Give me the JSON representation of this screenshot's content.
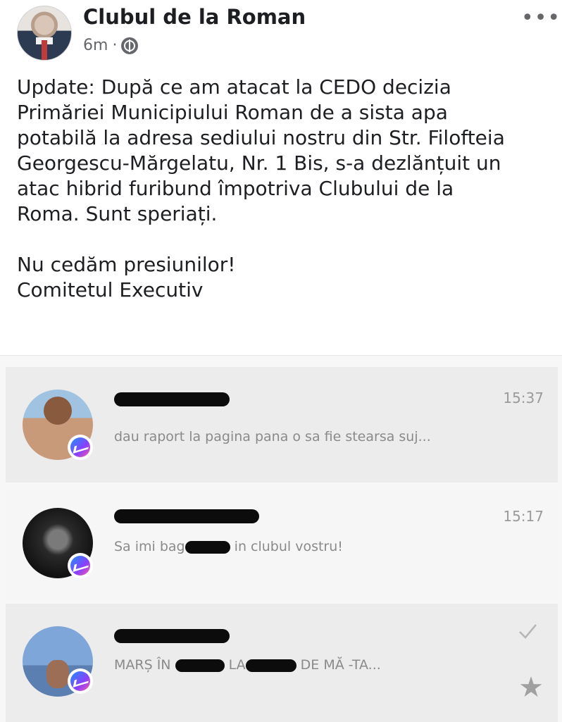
{
  "post": {
    "author": "Clubul de la Roman",
    "time": "6m",
    "separator": "·",
    "audience_icon": "globe-icon",
    "more_icon": "•••",
    "paragraph1": [
      "Update: După ce am atacat la CEDO decizia",
      "Primăriei Municipiului Roman de a sista apa",
      "potabilă la adresa sediului nostru din Str. Filofteia",
      "Georgescu-Mărgelatu, Nr. 1 Bis, s-a dezlănțuit un",
      "atac hibrid furibund împotriva Clubului de la",
      "Roma. Sunt speriați."
    ],
    "paragraph2": [
      "Nu cedăm presiunilor!",
      "Comitetul Executiv"
    ]
  },
  "messages": [
    {
      "time": "15:37",
      "preview": "dau raport la pagina pana o sa fie stearsa suj...",
      "badge_icon": "messenger-icon"
    },
    {
      "time": "15:17",
      "preview_a": "Sa imi bag",
      "preview_b": " in clubul vostru!",
      "badge_icon": "messenger-icon"
    },
    {
      "preview_a": "MARȘ ÎN ",
      "preview_b": " LA",
      "preview_c": " DE MĂ -TA...",
      "status_icon": "check-icon",
      "star_icon": "star-icon",
      "star_glyph": "★",
      "badge_icon": "messenger-icon"
    }
  ],
  "colors": {
    "text": "#1c1e21",
    "muted": "#65676b",
    "redaction": "#0c0c0c"
  }
}
